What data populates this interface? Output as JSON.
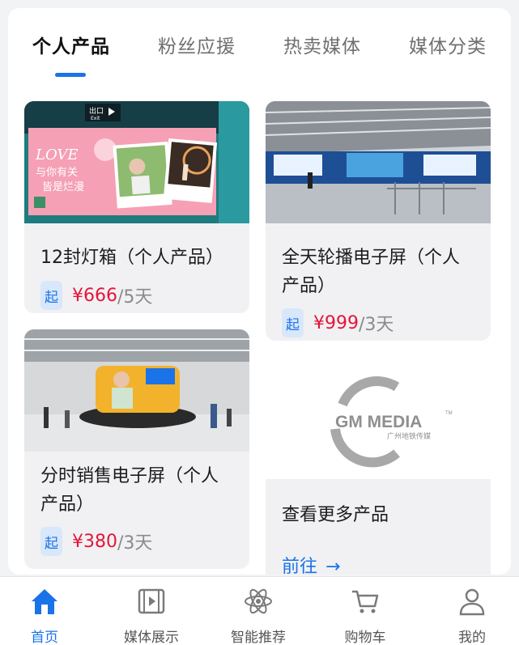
{
  "tabs": [
    {
      "label": "个人产品",
      "active": true
    },
    {
      "label": "粉丝应援",
      "active": false
    },
    {
      "label": "热卖媒体",
      "active": false
    },
    {
      "label": "媒体分类",
      "active": false
    }
  ],
  "products": [
    {
      "title": "12封灯箱（个人产品）",
      "badge": "起",
      "price": "¥666",
      "unit": "/5天",
      "image": {
        "exit_sign": "出口",
        "exit_sub": "Exit",
        "headline": "LOVE",
        "line1": "与你有关",
        "line2": "皆是烂漫"
      }
    },
    {
      "title": "全天轮播电子屏（个人产品）",
      "badge": "起",
      "price": "¥999",
      "unit": "/3天"
    },
    {
      "title": "分时销售电子屏（个人产品）",
      "badge": "起",
      "price": "¥380",
      "unit": "/3天"
    }
  ],
  "logo": {
    "text": "GM MEDIA",
    "tm": "TM",
    "subtitle": "广州地铁传媒"
  },
  "more": {
    "title": "查看更多产品",
    "link": "前往",
    "arrow": "→"
  },
  "nav": [
    {
      "label": "首页",
      "icon": "home-icon",
      "active": true
    },
    {
      "label": "媒体展示",
      "icon": "film-icon",
      "active": false
    },
    {
      "label": "智能推荐",
      "icon": "atom-icon",
      "active": false
    },
    {
      "label": "购物车",
      "icon": "cart-icon",
      "active": false
    },
    {
      "label": "我的",
      "icon": "user-icon",
      "active": false
    }
  ],
  "colors": {
    "accent": "#1a73e8",
    "price": "#e4163a",
    "badge_bg": "#d9e7fb",
    "card_bg": "#f1f1f3"
  }
}
